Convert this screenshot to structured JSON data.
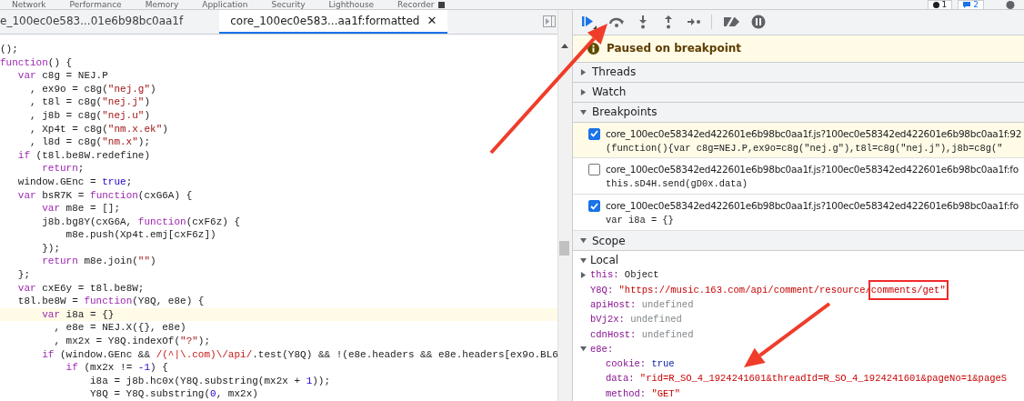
{
  "top_tabs": [
    "Network",
    "Performance",
    "Memory",
    "Application",
    "Security",
    "Lighthouse",
    "Recorder"
  ],
  "top_badges": [
    {
      "kind": "errors",
      "count": "1"
    },
    {
      "kind": "messages",
      "count": "2"
    }
  ],
  "editor_tabs": [
    {
      "label": "e_100ec0e583...01e6b98bc0aa1f",
      "selected": false
    },
    {
      "label": "core_100ec0e583...aa1f:formatted",
      "selected": true,
      "close": "✕"
    }
  ],
  "code_lines": [
    {
      "current": false,
      "tokens": [
        {
          "kind": "plain",
          "text": "();"
        }
      ]
    },
    {
      "current": false,
      "tokens": [
        {
          "kind": "keyword",
          "text": "function"
        },
        {
          "kind": "plain",
          "text": "() {"
        }
      ]
    },
    {
      "current": false,
      "tokens": [
        {
          "kind": "keyword",
          "text": "   var"
        },
        {
          "kind": "plain",
          "text": " c8g = NEJ.P"
        }
      ]
    },
    {
      "current": false,
      "tokens": [
        {
          "kind": "plain",
          "text": "     , ex9o = c8g("
        },
        {
          "kind": "string",
          "text": "\"nej.g\""
        },
        {
          "kind": "plain",
          "text": ")"
        }
      ]
    },
    {
      "current": false,
      "tokens": [
        {
          "kind": "plain",
          "text": "     , t8l = c8g("
        },
        {
          "kind": "string",
          "text": "\"nej.j\""
        },
        {
          "kind": "plain",
          "text": ")"
        }
      ]
    },
    {
      "current": false,
      "tokens": [
        {
          "kind": "plain",
          "text": "     , j8b = c8g("
        },
        {
          "kind": "string",
          "text": "\"nej.u\""
        },
        {
          "kind": "plain",
          "text": ")"
        }
      ]
    },
    {
      "current": false,
      "tokens": [
        {
          "kind": "plain",
          "text": "     , Xp4t = c8g("
        },
        {
          "kind": "string",
          "text": "\"nm.x.ek\""
        },
        {
          "kind": "plain",
          "text": ")"
        }
      ]
    },
    {
      "current": false,
      "tokens": [
        {
          "kind": "plain",
          "text": "     , l8d = c8g("
        },
        {
          "kind": "string",
          "text": "\"nm.x\""
        },
        {
          "kind": "plain",
          "text": ");"
        }
      ]
    },
    {
      "current": false,
      "tokens": [
        {
          "kind": "keyword",
          "text": "   if"
        },
        {
          "kind": "plain",
          "text": " (t8l.be8W.redefine)"
        }
      ]
    },
    {
      "current": false,
      "tokens": [
        {
          "kind": "keyword",
          "text": "       return"
        },
        {
          "kind": "plain",
          "text": ";"
        }
      ]
    },
    {
      "current": false,
      "tokens": [
        {
          "kind": "plain",
          "text": "   window.GEnc = "
        },
        {
          "kind": "atom",
          "text": "true"
        },
        {
          "kind": "plain",
          "text": ";"
        }
      ]
    },
    {
      "current": false,
      "tokens": [
        {
          "kind": "keyword",
          "text": "   var"
        },
        {
          "kind": "plain",
          "text": " bsR7K = "
        },
        {
          "kind": "keyword",
          "text": "function"
        },
        {
          "kind": "plain",
          "text": "(cxG6A) {"
        }
      ]
    },
    {
      "current": false,
      "tokens": [
        {
          "kind": "keyword",
          "text": "       var"
        },
        {
          "kind": "plain",
          "text": " m8e = [];"
        }
      ]
    },
    {
      "current": false,
      "tokens": [
        {
          "kind": "plain",
          "text": "       j8b.bg8Y(cxG6A, "
        },
        {
          "kind": "keyword",
          "text": "function"
        },
        {
          "kind": "plain",
          "text": "(cxF6z) {"
        }
      ]
    },
    {
      "current": false,
      "tokens": [
        {
          "kind": "plain",
          "text": "           m8e.push(Xp4t.emj[cxF6z])"
        }
      ]
    },
    {
      "current": false,
      "tokens": [
        {
          "kind": "plain",
          "text": "       });"
        }
      ]
    },
    {
      "current": false,
      "tokens": [
        {
          "kind": "keyword",
          "text": "       return"
        },
        {
          "kind": "plain",
          "text": " m8e.join("
        },
        {
          "kind": "string",
          "text": "\"\""
        },
        {
          "kind": "plain",
          "text": ")"
        }
      ]
    },
    {
      "current": false,
      "tokens": [
        {
          "kind": "plain",
          "text": "   };"
        }
      ]
    },
    {
      "current": false,
      "tokens": [
        {
          "kind": "keyword",
          "text": "   var"
        },
        {
          "kind": "plain",
          "text": " cxE6y = t8l.be8W;"
        }
      ]
    },
    {
      "current": false,
      "tokens": [
        {
          "kind": "plain",
          "text": "   t8l.be8W = "
        },
        {
          "kind": "keyword",
          "text": "function"
        },
        {
          "kind": "plain",
          "text": "(Y8Q, e8e) {"
        }
      ]
    },
    {
      "current": true,
      "tokens": [
        {
          "kind": "keyword",
          "text": "       var"
        },
        {
          "kind": "plain",
          "text": " i8a = {}"
        }
      ]
    },
    {
      "current": false,
      "tokens": [
        {
          "kind": "plain",
          "text": "         , e8e = NEJ.X({}, e8e)"
        }
      ]
    },
    {
      "current": false,
      "tokens": [
        {
          "kind": "plain",
          "text": "         , mx2x = Y8Q.indexOf("
        },
        {
          "kind": "string",
          "text": "\"?\""
        },
        {
          "kind": "plain",
          "text": ");"
        }
      ]
    },
    {
      "current": false,
      "tokens": [
        {
          "kind": "keyword",
          "text": "       if"
        },
        {
          "kind": "plain",
          "text": " (window.GEnc && "
        },
        {
          "kind": "regex",
          "text": "/(^|\\.com)\\/api/"
        },
        {
          "kind": "plain",
          "text": ".test(Y8Q) && !(e8e.headers && e8e.headers[ex9o.BL6"
        }
      ]
    },
    {
      "current": false,
      "tokens": [
        {
          "kind": "keyword",
          "text": "           if"
        },
        {
          "kind": "plain",
          "text": " (mx2x != "
        },
        {
          "kind": "number",
          "text": "-1"
        },
        {
          "kind": "plain",
          "text": ") {"
        }
      ]
    },
    {
      "current": false,
      "tokens": [
        {
          "kind": "plain",
          "text": "               i8a = j8b.hc0x(Y8Q.substring(mx2x + "
        },
        {
          "kind": "number",
          "text": "1"
        },
        {
          "kind": "plain",
          "text": "));"
        }
      ]
    },
    {
      "current": false,
      "tokens": [
        {
          "kind": "plain",
          "text": "               Y8Q = Y8Q.substring("
        },
        {
          "kind": "number",
          "text": "0"
        },
        {
          "kind": "plain",
          "text": ", mx2x)"
        }
      ]
    }
  ],
  "debugger_toolbar": [
    {
      "kind": "resume"
    },
    {
      "kind": "step-over"
    },
    {
      "kind": "step-into"
    },
    {
      "kind": "step-out"
    },
    {
      "kind": "step"
    },
    {
      "kind": "divider"
    },
    {
      "kind": "deactivate"
    },
    {
      "kind": "pause-exceptions"
    }
  ],
  "paused_banner": "Paused on breakpoint",
  "sections": [
    {
      "title": "Threads",
      "expanded": false
    },
    {
      "title": "Watch",
      "expanded": false
    },
    {
      "title": "Breakpoints",
      "expanded": true
    }
  ],
  "breakpoints": [
    {
      "file": "core_100ec0e58342ed422601e6b98bc0aa1f.js?100ec0e58342ed422601e6b98bc0aa1f:92",
      "code": "(function(){var c8g=NEJ.P,ex9o=c8g(\"nej.g\"),t8l=c8g(\"nej.j\"),j8b=c8g(\"",
      "checked": true,
      "selected": true
    },
    {
      "file": "core_100ec0e58342ed422601e6b98bc0aa1f.js?100ec0e58342ed422601e6b98bc0aa1f:fo",
      "code": "this.sD4H.send(gD0x.data)",
      "checked": false,
      "selected": false
    },
    {
      "file": "core_100ec0e58342ed422601e6b98bc0aa1f.js?100ec0e58342ed422601e6b98bc0aa1f:fo",
      "code": "var i8a = {}",
      "checked": true,
      "selected": false
    }
  ],
  "scope": {
    "title": "Scope",
    "expanded": true,
    "groups": [
      {
        "name": "Local",
        "expanded": true,
        "items": [
          {
            "name": "this:",
            "value": "Object",
            "kind": "object",
            "expanded": false
          },
          {
            "name": "Y8Q:",
            "value": "\"https://music.163.com/api/comment/resource/",
            "boxed": "comments/get\"",
            "kind": "string"
          },
          {
            "name": "apiHost:",
            "value": "undefined",
            "kind": "undefined"
          },
          {
            "name": "bVj2x:",
            "value": "undefined",
            "kind": "undefined"
          },
          {
            "name": "cdnHost:",
            "value": "undefined",
            "kind": "undefined"
          },
          {
            "name": "e8e:",
            "kind": "object",
            "expanded": true,
            "children": [
              {
                "name": "cookie:",
                "value": "true",
                "kind": "boolean"
              },
              {
                "name": "data:",
                "value": "\"rid=R_SO_4_1924241601&threadId=R_SO_4_1924241601&pageNo=1&pageS",
                "kind": "string"
              },
              {
                "name": "method:",
                "value": "\"GET\"",
                "kind": "string"
              }
            ]
          }
        ]
      }
    ]
  },
  "annotations": [
    {
      "kind": "arrow"
    },
    {
      "kind": "arrow"
    }
  ]
}
